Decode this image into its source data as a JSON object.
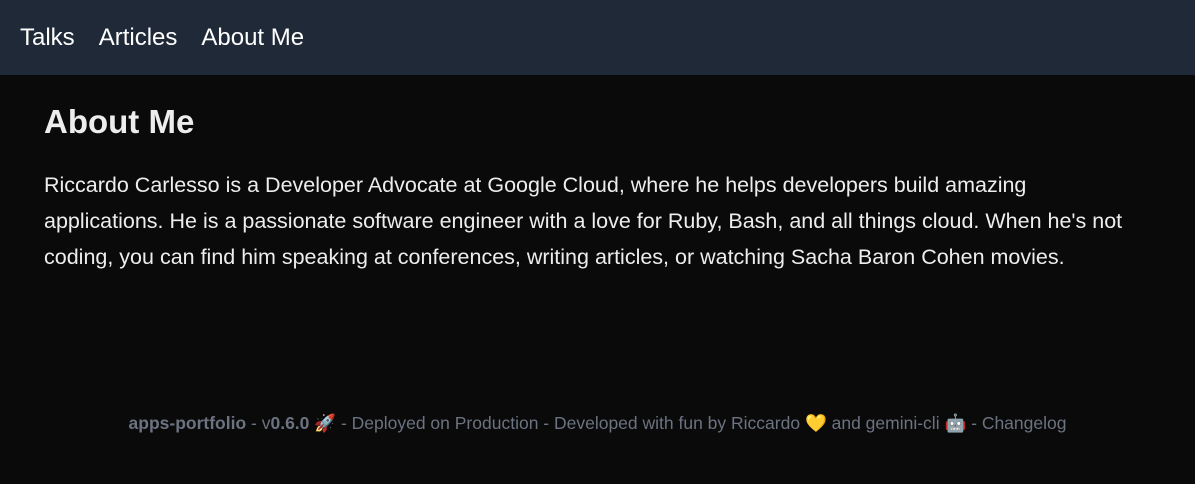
{
  "nav": {
    "items": [
      "Talks",
      "Articles",
      "About Me"
    ]
  },
  "page": {
    "title": "About Me",
    "bio": "Riccardo Carlesso is a Developer Advocate at Google Cloud, where he helps developers build amazing applications. He is a passionate software engineer with a love for Ruby, Bash, and all things cloud. When he's not coding, you can find him speaking at conferences, writing articles, or watching Sacha Baron Cohen movies."
  },
  "footer": {
    "app": "apps-portfolio",
    "sep1": " - v",
    "version": "0.6.0",
    "rocket": "🚀",
    "deployed": " - Deployed on Production - Developed with fun by Riccardo ",
    "heart": "💛",
    "and": " and gemini-cli ",
    "robot": "🤖",
    "sep2": " - ",
    "changelog": "Changelog"
  }
}
